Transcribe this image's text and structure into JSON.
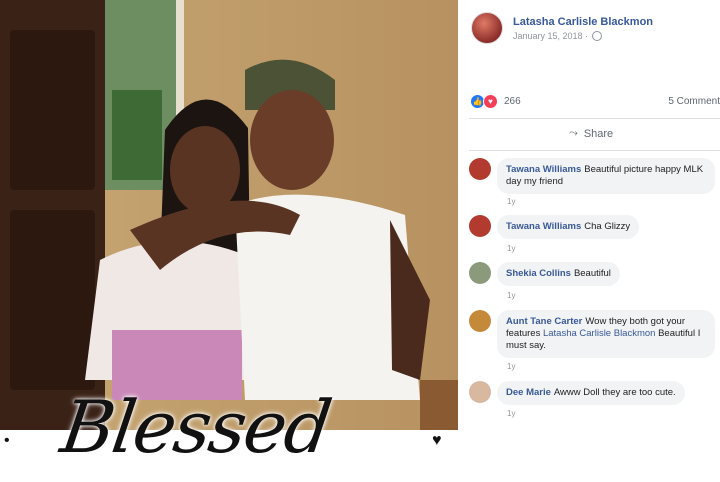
{
  "post": {
    "author": "Latasha Carlisle Blackmon",
    "date": "January 15, 2018 ·",
    "reaction_count": "266",
    "comments_count": "5 Comment",
    "share_label": "Share"
  },
  "overlay": {
    "caption": "Blessed",
    "left_bullet": "•",
    "right_heart": "♥"
  },
  "comments": [
    {
      "name": "Tawana Williams",
      "text": "Beautiful picture happy MLK day my friend",
      "time": "1y"
    },
    {
      "name": "Tawana Williams",
      "text": "Cha Glizzy",
      "time": "1y"
    },
    {
      "name": "Shekia Collins",
      "text": "Beautiful",
      "time": "1y"
    },
    {
      "name": "Aunt Tane Carter",
      "text": "Wow they both got your features",
      "mention": "Latasha Carlisle Blackmon",
      "text2": "Beautiful I must say.",
      "time": "1y"
    },
    {
      "name": "Dee Marie",
      "text": "Awww Doll they are too cute.",
      "time": "1y"
    }
  ],
  "colors": {
    "link": "#385898",
    "like": "#2078f4",
    "love": "#f33e58",
    "bubble": "#f2f3f5"
  }
}
